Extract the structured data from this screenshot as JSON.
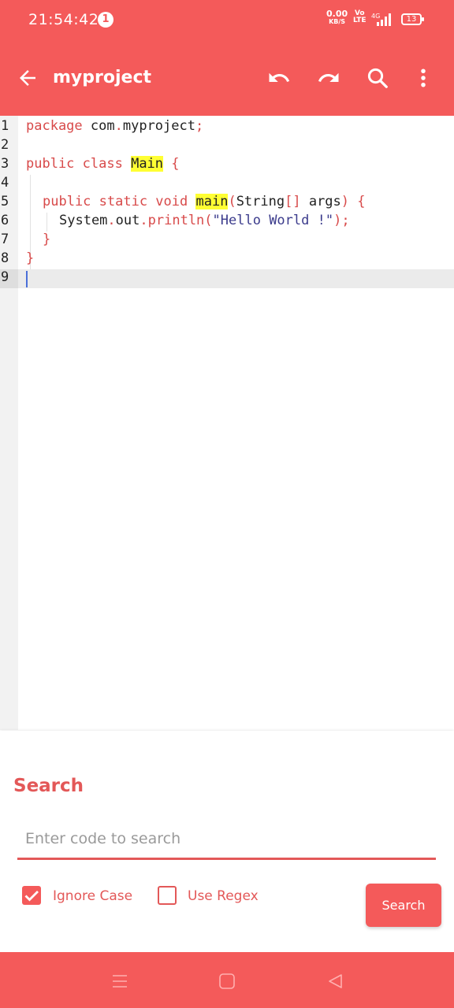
{
  "status_bar": {
    "time": "21:54:42",
    "notification_count": "1",
    "net_speed_value": "0.00",
    "net_speed_unit": "KB/S",
    "volte_top": "Vo",
    "volte_bottom": "LTE",
    "network": "4G",
    "battery": "13"
  },
  "app_bar": {
    "title": "myproject",
    "icons": [
      "back-arrow-icon",
      "undo-icon",
      "redo-icon",
      "search-icon",
      "more-vert-icon"
    ]
  },
  "editor": {
    "line_numbers": [
      "1",
      "2",
      "3",
      "4",
      "5",
      "6",
      "7",
      "8",
      "9"
    ],
    "code": {
      "l1_kw": "package",
      "l1_pkg": " com",
      "l1_dot": ".",
      "l1_name": "myproject",
      "l1_semi": ";",
      "l3_kw": "public class",
      "l3_sp": " ",
      "l3_cls": "Main",
      "l3_brace": " {",
      "l5_kw": "public static void",
      "l5_sp": " ",
      "l5_fn": "main",
      "l5_open": "(",
      "l5_type": "String",
      "l5_arr": "[]",
      "l5_args": " args",
      "l5_close": ")",
      "l5_brace": " {",
      "l6_obj": "System",
      "l6_dot1": ".",
      "l6_out": "out",
      "l6_dot2": ".",
      "l6_fn": "println",
      "l6_open": "(",
      "l6_str": "\"Hello World !\"",
      "l6_close": ");",
      "l7_brace": "}",
      "l8_brace": "}"
    },
    "current_line": 9
  },
  "search_panel": {
    "title": "Search",
    "placeholder": "Enter code to search",
    "value": "",
    "ignore_case_label": "Ignore Case",
    "ignore_case_checked": true,
    "use_regex_label": "Use Regex",
    "use_regex_checked": false,
    "submit_label": "Search"
  },
  "nav_bar": {
    "icons": [
      "menu-lines-icon",
      "home-square-icon",
      "back-triangle-icon"
    ]
  },
  "colors": {
    "accent": "#f45a5a",
    "keyword": "#d84a4a",
    "highlight": "#ffff33",
    "string": "#3b3b8c"
  }
}
